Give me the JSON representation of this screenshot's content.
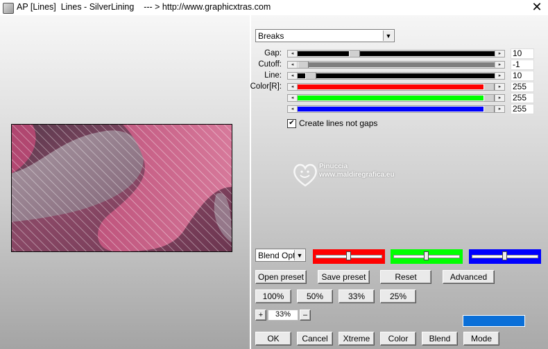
{
  "window": {
    "title": "AP [Lines]  Lines - SilverLining    --- > http://www.graphicxtras.com",
    "close_symbol": "✕"
  },
  "mode_select": {
    "value": "Breaks"
  },
  "controls": [
    {
      "label": "Gap:",
      "value": "10",
      "fill_color": "#000000",
      "level": 0.26
    },
    {
      "label": "Cutoff:",
      "value": "-1",
      "fill_color": "#7f7f7f",
      "level": 0.0
    },
    {
      "label": "Line:",
      "value": "10",
      "fill_color": "#000000",
      "level": 0.04
    },
    {
      "label": "Color[R]:",
      "value": "255",
      "fill_color": "#ff0000",
      "level": 1.0
    },
    {
      "label": "",
      "value": "255",
      "fill_color": "#00ff00",
      "level": 1.0
    },
    {
      "label": "",
      "value": "255",
      "fill_color": "#0000ff",
      "level": 1.0
    }
  ],
  "checkbox": {
    "label": "Create lines not gaps",
    "checked": true,
    "mark": "✔"
  },
  "watermark": {
    "name": "Pinuccia",
    "site": "www.maldiregrafica.eu"
  },
  "blend_select": {
    "value": "Blend Optio"
  },
  "color_swatches": [
    {
      "color": "#ff0000",
      "level": 0.5
    },
    {
      "color": "#00ff00",
      "level": 0.5
    },
    {
      "color": "#0000ff",
      "level": 0.5
    }
  ],
  "preset_buttons": {
    "open": "Open preset",
    "save": "Save preset",
    "reset": "Reset",
    "advanced": "Advanced"
  },
  "zoom_buttons": [
    "100%",
    "50%",
    "33%",
    "25%"
  ],
  "zoom": {
    "plus": "+",
    "value": "33%",
    "minus": "–"
  },
  "accent_color": "#0a6fd8",
  "bottom_buttons": {
    "ok": "OK",
    "cancel": "Cancel",
    "xtreme": "Xtreme",
    "color": "Color",
    "blend": "Blend",
    "mode": "Mode"
  },
  "icons": {
    "app": "app-icon",
    "close": "close-icon",
    "dropdown": "chevron-down-icon",
    "slider_left": "arrow-left-icon",
    "slider_right": "arrow-right-icon",
    "check": "checkmark-icon"
  }
}
